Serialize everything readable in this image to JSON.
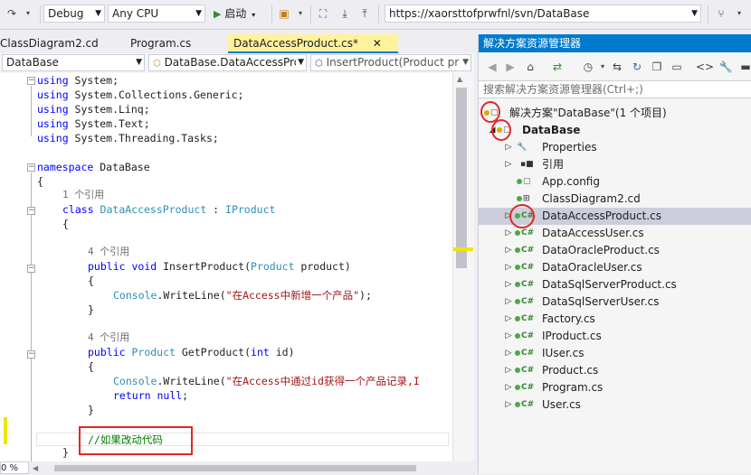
{
  "toolbar": {
    "config_value": "Debug",
    "platform_value": "Any CPU",
    "start_label": "启动",
    "url_value": "https://xaorsttofprwfnl/svn/DataBase"
  },
  "tabs": [
    {
      "label": "ClassDiagram2.cd"
    },
    {
      "label": "Program.cs"
    },
    {
      "label": "DataAccessProduct.cs*"
    }
  ],
  "tab_close": "✕",
  "navbar": {
    "project": "DataBase",
    "class": "DataBase.DataAccessPrc",
    "member": "InsertProduct(Product pr"
  },
  "code": {
    "l1_kw": "using",
    "l1_rest": " System;",
    "l2_kw": "using",
    "l2_rest": " System.Collections.Generic;",
    "l3_kw": "using",
    "l3_rest": " System.Linq;",
    "l4_kw": "using",
    "l4_rest": " System.Text;",
    "l5_kw": "using",
    "l5_rest": " System.Threading.Tasks;",
    "ns_kw": "namespace",
    "ns_name": " DataBase",
    "brace_open": "{",
    "brace_close": "}",
    "ref1": "1 个引用",
    "class_kw": "class",
    "class_name": " DataAccessProduct",
    "class_colon": " : ",
    "class_base": "IProduct",
    "ref4a": "4 个引用",
    "m1_kw1": "public",
    "m1_kw2": " void",
    "m1_name": " InsertProduct(",
    "m1_type": "Product",
    "m1_param": " product)",
    "m1_call_type": "Console",
    "m1_call": ".WriteLine(",
    "m1_str": "\"在Access中新增一个产品\"",
    "m1_end": ");",
    "ref4b": "4 个引用",
    "m2_kw1": "public",
    "m2_type": " Product",
    "m2_name": " GetProduct(",
    "m2_kw2": "int",
    "m2_param": " id)",
    "m2_call_type": "Console",
    "m2_call": ".WriteLine(",
    "m2_str": "\"在Access中通过id获得一个产品记录,I",
    "m2_ret_kw": "return",
    "m2_ret_kw2": " null",
    "m2_ret_end": ";",
    "comment": "//如果改动代码"
  },
  "bottombar": {
    "zoom": "0 %"
  },
  "solution_explorer": {
    "title": "解决方案资源管理器",
    "search_placeholder": "搜索解决方案资源管理器(Ctrl+;)",
    "solution_label": "解决方案\"DataBase\"(1 个项目)",
    "project_label": "DataBase",
    "items": [
      {
        "label": "Properties"
      },
      {
        "label": "引用"
      },
      {
        "label": "App.config"
      },
      {
        "label": "ClassDiagram2.cd"
      },
      {
        "label": "DataAccessProduct.cs"
      },
      {
        "label": "DataAccessUser.cs"
      },
      {
        "label": "DataOracleProduct.cs"
      },
      {
        "label": "DataOracleUser.cs"
      },
      {
        "label": "DataSqlServerProduct.cs"
      },
      {
        "label": "DataSqlServerUser.cs"
      },
      {
        "label": "Factory.cs"
      },
      {
        "label": "IProduct.cs"
      },
      {
        "label": "IUser.cs"
      },
      {
        "label": "Product.cs"
      },
      {
        "label": "Program.cs"
      },
      {
        "label": "User.cs"
      }
    ],
    "cs_icon_text": "C#"
  }
}
